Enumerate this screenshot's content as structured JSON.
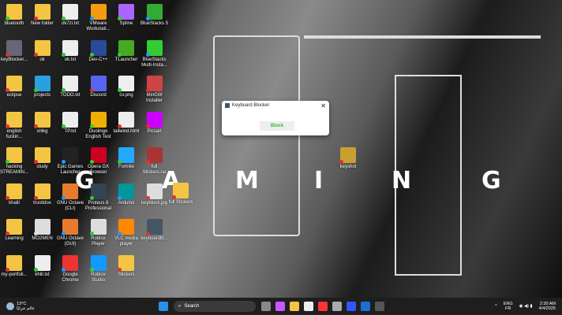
{
  "desktop": {
    "columns": [
      [
        [
          "bluetooth",
          "#f4c542",
          "#3c3"
        ],
        [
          "keyBlocker...",
          "#667",
          "#d33"
        ],
        [
          "eclipse",
          "#f4c542",
          "#d33"
        ],
        [
          "english fuckin...",
          "#f4c542",
          "#d33"
        ],
        [
          "hacking STREAMIN...",
          "#f4c542",
          "#3c3"
        ],
        [
          "khalil",
          "#f4c542",
          "#d33"
        ],
        [
          "Learning",
          "#f4c542",
          "#d33"
        ],
        [
          "my-portfoli...",
          "#f4c542",
          "#d33"
        ]
      ],
      [
        [
          "New folder",
          "#f4c542",
          "#d33"
        ],
        [
          "ok",
          "#f4c542",
          "#d33"
        ],
        [
          "projects",
          "#2aa0e0",
          "#3c3"
        ],
        [
          "shikg",
          "#f4c542",
          "#d33"
        ],
        [
          "study",
          "#f4c542",
          "#d33"
        ],
        [
          "trustidox",
          "#f4c542",
          "#d33"
        ],
        [
          "MO2MEN",
          "#ddd",
          "#ddd"
        ],
        [
          "khlil.txt",
          "#eee",
          "#3c3"
        ]
      ],
      [
        [
          "ok7zi.txt",
          "#eee",
          "#3c3"
        ],
        [
          "ok.txt",
          "#eee",
          "#3c3"
        ],
        [
          "TODO.txt",
          "#eee",
          "#3c3"
        ],
        [
          "TP.txt",
          "#eee",
          "#3c3"
        ],
        [
          "Epic Games Launcher",
          "#222",
          "#29f"
        ],
        [
          "GNU Octave (CLI)",
          "#e87b2b",
          "#29f"
        ],
        [
          "GNU Octave (GUI)",
          "#e87b2b",
          "#29f"
        ],
        [
          "Google Chrome",
          "#e33",
          "#29f"
        ]
      ],
      [
        [
          "VMware Workstati...",
          "#f39c12",
          "#29f"
        ],
        [
          "Dev-C++",
          "#2a4a9a",
          "#3c3"
        ],
        [
          "Discord",
          "#5865f2",
          "#d33"
        ],
        [
          "Duolingo English Test",
          "#f0b000",
          "#3c3"
        ],
        [
          "Opera GX Browser",
          "#c02",
          "#3c3"
        ],
        [
          "Proteus 8 Professional",
          "#345",
          "#3c3"
        ],
        [
          "Roblox Player",
          "#ddd",
          "#3c3"
        ],
        [
          "Roblox Studio",
          "#19f",
          "#3c3"
        ]
      ],
      [
        [
          "Spline",
          "#a6f",
          "#3c3"
        ],
        [
          "TLauncher",
          "#4a2",
          "#3c3"
        ],
        [
          "cv.png",
          "#eee",
          "#3c3"
        ],
        [
          "tailwind.html",
          "#eee",
          "#d33"
        ],
        [
          "Fortnite",
          "#2af",
          "#3c3"
        ],
        [
          "Arduino",
          "#00979c",
          "#29f"
        ],
        [
          "VLC media player",
          "#f80",
          "#29f"
        ],
        [
          "Stickers",
          "#f4c542",
          "#d33"
        ]
      ],
      [
        [
          "BlueStacks 5",
          "#3a3",
          "#29f"
        ],
        [
          "BlueStacks Multi-Insta...",
          "#3c3",
          "#29f"
        ],
        [
          "MinGW Installer",
          "#c44",
          "#d33"
        ],
        [
          "Picsart",
          "#c0f",
          "#d33"
        ],
        [
          "full Stickers.rar",
          "#a33",
          "#d33"
        ],
        [
          "keyblock.jpg",
          "#ddd",
          "#d33"
        ],
        [
          "keyboardbl...",
          "#456",
          "#d33"
        ]
      ]
    ],
    "extra": [
      [
        "full Stickers",
        "#f4c542",
        "#d33"
      ],
      [
        "keyshot",
        "#c9a030",
        "#d33"
      ]
    ],
    "wallpaper_letters": [
      "G",
      "A",
      "M",
      "I",
      "N",
      "G"
    ]
  },
  "dialog": {
    "title": "Keyboard Blocker",
    "close": "✕",
    "button": "Block"
  },
  "taskbar": {
    "weather_temp": "13°C",
    "weather_text": "غائم جزئيًا",
    "search": "Search",
    "lang1": "ENG",
    "lang2": "FR",
    "time": "2:30 AM",
    "date": "4/4/2025",
    "chevron": "^",
    "apps": [
      "#888",
      "#c5f",
      "#f4c542",
      "#eee",
      "#f33",
      "#aaa",
      "#35f",
      "#1a6fd0",
      "#555"
    ]
  }
}
